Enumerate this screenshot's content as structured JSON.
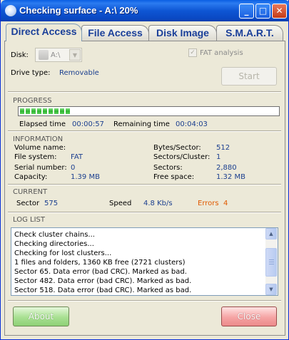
{
  "window": {
    "title": "Checking surface - A:\\ 20%",
    "controls": {
      "minimize": "_",
      "maximize": "□",
      "close": "✕"
    }
  },
  "tabs": [
    {
      "label": "Direct Access",
      "active": true
    },
    {
      "label": "File Access",
      "active": false
    },
    {
      "label": "Disk Image",
      "active": false
    },
    {
      "label": "S.M.A.R.T.",
      "active": false
    }
  ],
  "disk": {
    "label": "Disk:",
    "selected": "A:\\",
    "fat_analysis_label": "FAT analysis",
    "fat_analysis_checked": true,
    "drive_type_label": "Drive type:",
    "drive_type_value": "Removable",
    "start_label": "Start"
  },
  "progress": {
    "header": "PROGRESS",
    "value_fraction": 0.2,
    "elapsed_label": "Elapsed time",
    "elapsed_value": "00:00:57",
    "remaining_label": "Remaining time",
    "remaining_value": "00:04:03"
  },
  "information": {
    "header": "INFORMATION",
    "volume_name_label": "Volume name:",
    "volume_name_value": "",
    "file_system_label": "File system:",
    "file_system_value": "FAT",
    "serial_label": "Serial number:",
    "serial_value": "0",
    "capacity_label": "Capacity:",
    "capacity_value": "1.39 MB",
    "bytes_sector_label": "Bytes/Sector:",
    "bytes_sector_value": "512",
    "sectors_cluster_label": "Sectors/Cluster:",
    "sectors_cluster_value": "1",
    "sectors_label": "Sectors:",
    "sectors_value": "2,880",
    "free_space_label": "Free space:",
    "free_space_value": "1.32 MB"
  },
  "current": {
    "header": "CURRENT",
    "sector_label": "Sector",
    "sector_value": "575",
    "speed_label": "Speed",
    "speed_value": "4.8 Kb/s",
    "errors_label": "Errors",
    "errors_value": "4"
  },
  "log": {
    "header": "LOG LIST",
    "lines": [
      "Check cluster chains...",
      "Checking directories...",
      "Checking for lost clusters...",
      "1 files and folders, 1360 KB free (2721 clusters)",
      "Sector 65. Data error (bad CRC). Marked as bad.",
      "Sector 482. Data error (bad CRC). Marked as bad.",
      "Sector 518. Data error (bad CRC). Marked as bad."
    ]
  },
  "buttons": {
    "about": "About",
    "close": "Close"
  },
  "colors": {
    "value_text": "#1b3f8f",
    "errors": "#e05a00",
    "progress_green": "#2fb32f",
    "titlebar": "#0a5fe3"
  }
}
